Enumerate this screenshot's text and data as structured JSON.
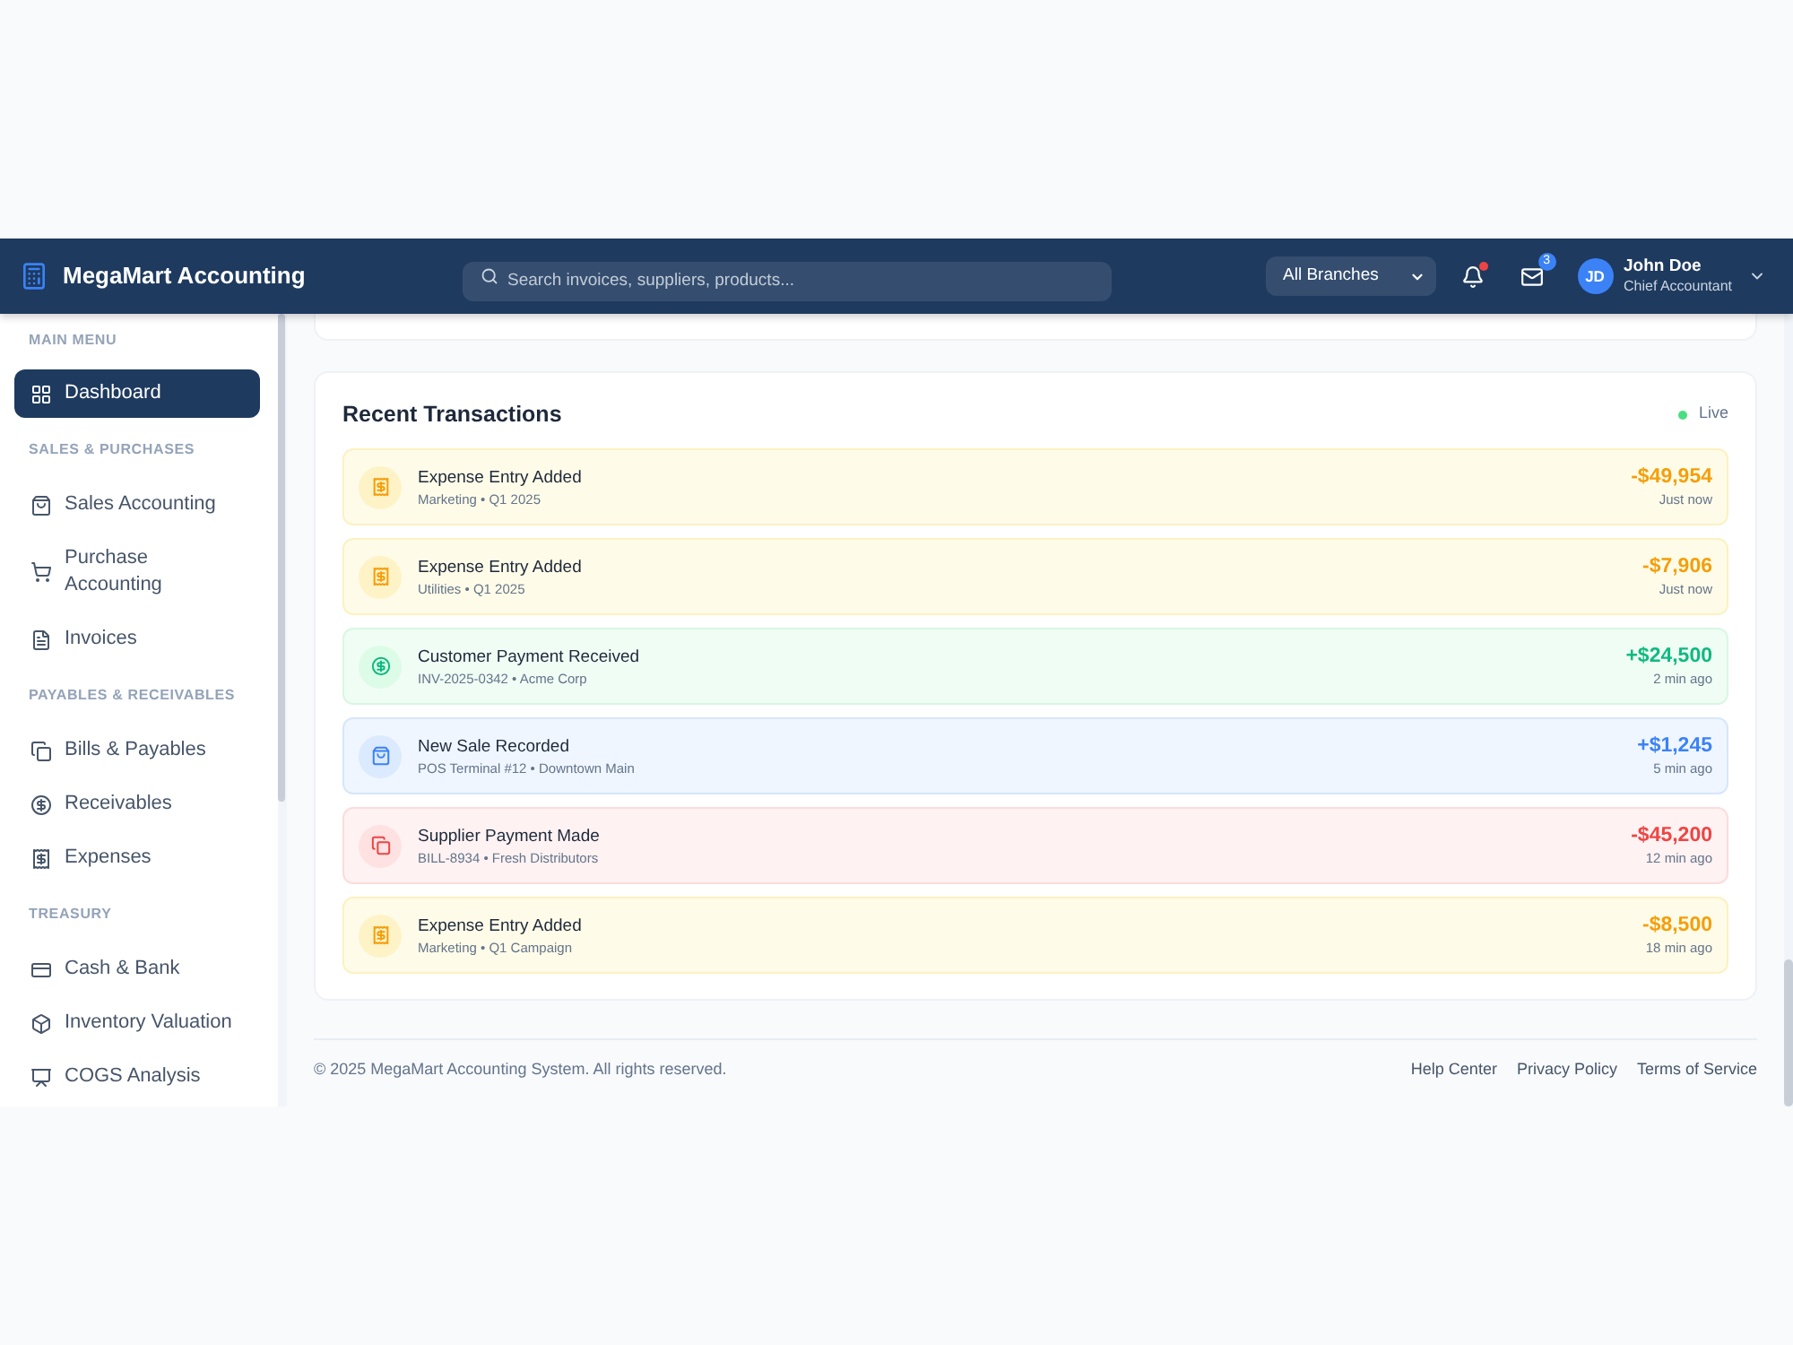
{
  "header": {
    "brand": "MegaMart Accounting",
    "search": {
      "placeholder": "Search invoices, suppliers, products..."
    },
    "branch_select": {
      "value": "All Branches"
    },
    "notifications": {
      "unread": true
    },
    "messages": {
      "count": "3"
    },
    "user": {
      "initials": "JD",
      "name": "John Doe",
      "role": "Chief Accountant"
    }
  },
  "sidebar": {
    "sections": [
      {
        "heading": "MAIN MENU",
        "items": [
          {
            "label": "Dashboard",
            "selected": true
          }
        ]
      },
      {
        "heading": "SALES & PURCHASES",
        "items": [
          {
            "label": "Sales Accounting",
            "selected": false
          },
          {
            "label": "Purchase Accounting",
            "selected": false
          },
          {
            "label": "Invoices",
            "selected": false
          }
        ]
      },
      {
        "heading": "PAYABLES & RECEIVABLES",
        "items": [
          {
            "label": "Bills & Payables",
            "selected": false
          },
          {
            "label": "Receivables",
            "selected": false
          },
          {
            "label": "Expenses",
            "selected": false
          }
        ]
      },
      {
        "heading": "TREASURY",
        "items": [
          {
            "label": "Cash & Bank",
            "selected": false
          },
          {
            "label": "Inventory Valuation",
            "selected": false
          },
          {
            "label": "COGS Analysis",
            "selected": false
          }
        ]
      }
    ]
  },
  "recent_transactions": {
    "title": "Recent Transactions",
    "live": {
      "label": "Live",
      "on": true
    },
    "items": [
      {
        "kind": "expense",
        "title": "Expense Entry Added",
        "details": "Marketing • Q1 2025",
        "amount": "-$49,954",
        "time": "Just now"
      },
      {
        "kind": "expense",
        "title": "Expense Entry Added",
        "details": "Utilities • Q1 2025",
        "amount": "-$7,906",
        "time": "Just now"
      },
      {
        "kind": "payment_in",
        "title": "Customer Payment Received",
        "details": "INV-2025-0342 • Acme Corp",
        "amount": "+$24,500",
        "time": "2 min ago"
      },
      {
        "kind": "sale",
        "title": "New Sale Recorded",
        "details": "POS Terminal #12 • Downtown Main",
        "amount": "+$1,245",
        "time": "5 min ago"
      },
      {
        "kind": "payment_out",
        "title": "Supplier Payment Made",
        "details": "BILL-8934 • Fresh Distributors",
        "amount": "-$45,200",
        "time": "12 min ago"
      },
      {
        "kind": "expense",
        "title": "Expense Entry Added",
        "details": "Marketing • Q1 Campaign",
        "amount": "-$8,500",
        "time": "18 min ago"
      }
    ]
  },
  "footer": {
    "copyright": "© 2025 MegaMart Accounting System. All rights reserved.",
    "links": [
      "Help Center",
      "Privacy Policy",
      "Terms of Service"
    ]
  }
}
